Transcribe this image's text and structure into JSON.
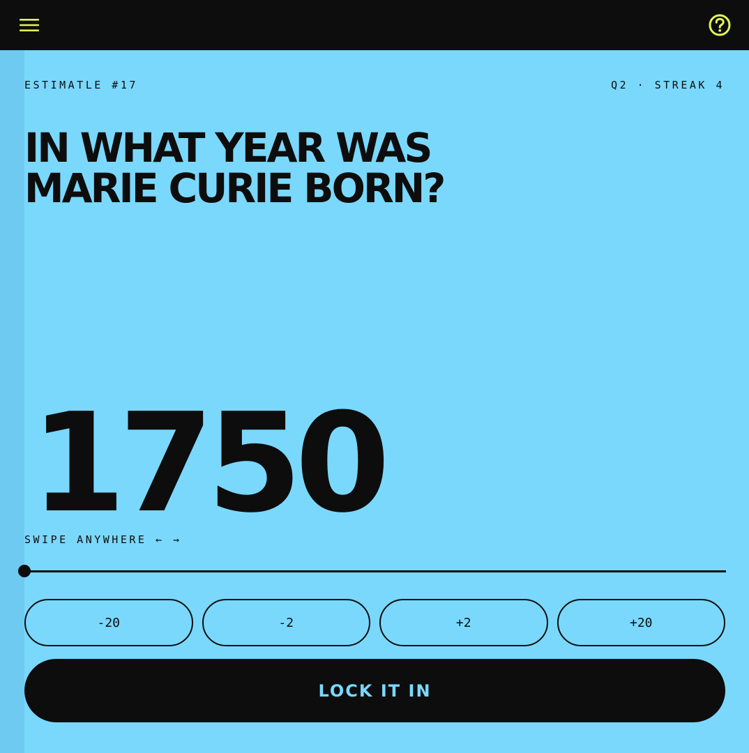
{
  "colors": {
    "background": "#7ad8fd",
    "strip": "#6fcaf1",
    "ink": "#0d0d0d",
    "accent": "#e4f55a"
  },
  "header": {
    "menu_icon": "hamburger-menu-icon",
    "help_icon": "help-circle-icon"
  },
  "meta": {
    "game_label": "ESTIMATLE #17",
    "progress_label": "Q2 · STREAK 4"
  },
  "question": {
    "text": "IN WHAT YEAR WAS MARIE CURIE BORN?"
  },
  "estimate": {
    "value": "1750",
    "hint": "SWIPE ANYWHERE ← →"
  },
  "slider": {
    "position_fraction": 0
  },
  "steps": {
    "minus_20": "-20",
    "minus_2": "-2",
    "plus_2": "+2",
    "plus_20": "+20"
  },
  "submit": {
    "label": "LOCK IT IN"
  }
}
